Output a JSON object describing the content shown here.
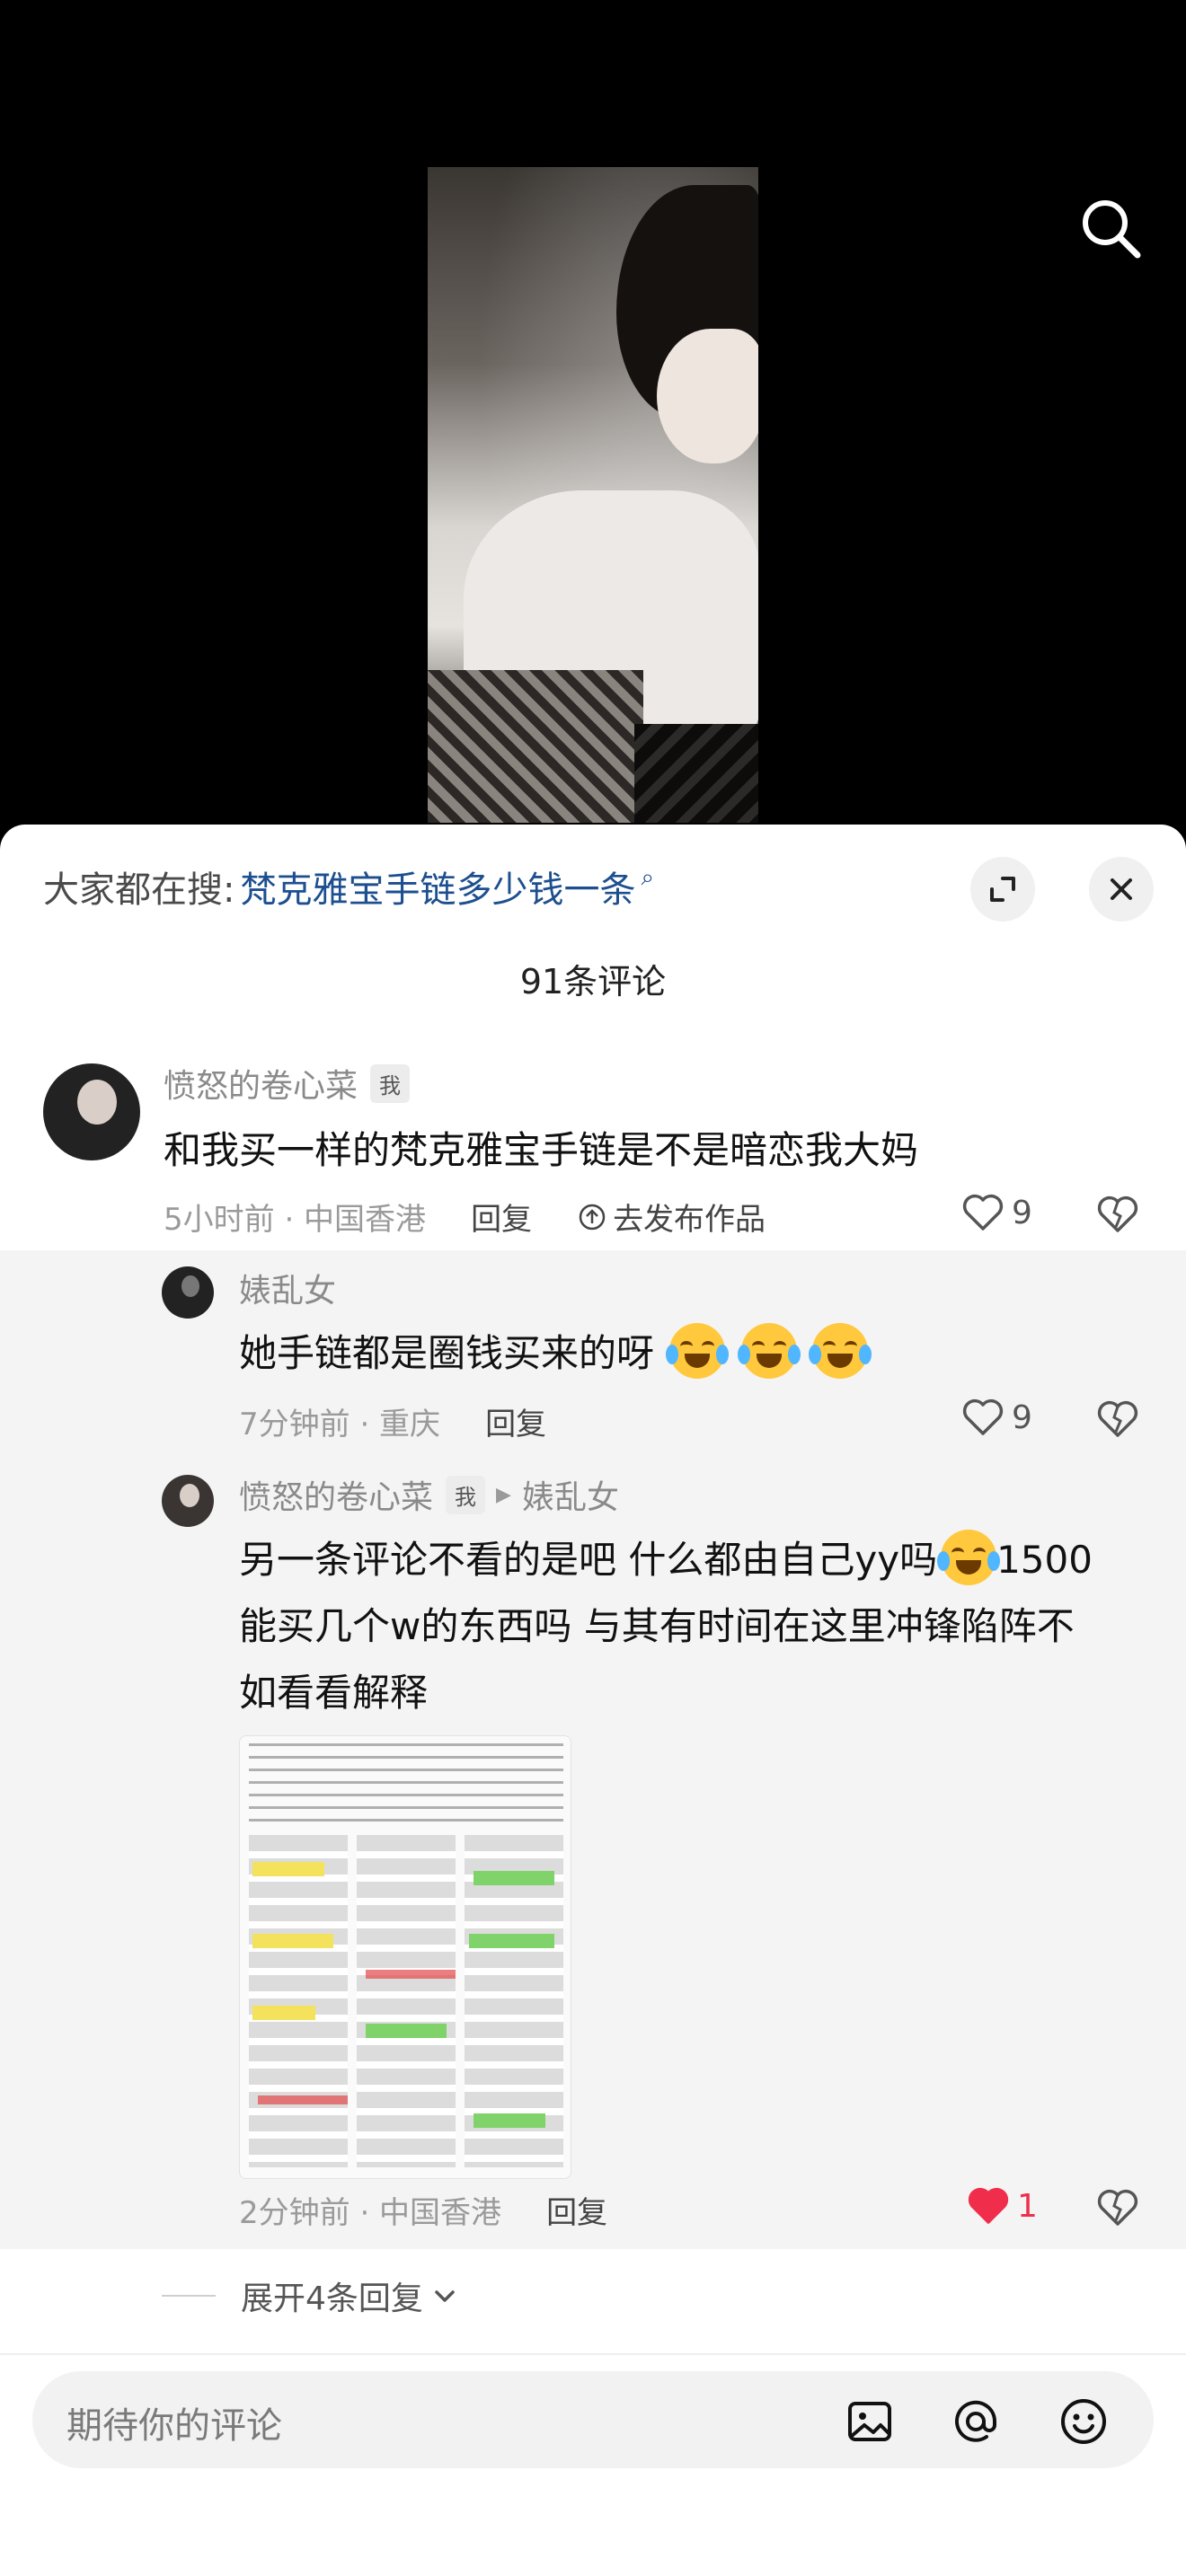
{
  "hot_search": {
    "prefix": "大家都在搜:",
    "term": "梵克雅宝手链多少钱一条",
    "search_glyph": "⌕"
  },
  "comment_count_title": "91条评论",
  "comments": [
    {
      "username": "愤怒的卷心菜",
      "me_tag": "我",
      "text": "和我买一样的梵克雅宝手链是不是暗恋我大妈",
      "meta": "5小时前 · 中国香港",
      "reply_label": "回复",
      "publish_label": "去发布作品",
      "likes": "9"
    }
  ],
  "replies": [
    {
      "username": "婊乱女",
      "text": "她手链都是圈钱买来的呀",
      "emoji_count": 3,
      "meta": "7分钟前 · 重庆",
      "reply_label": "回复",
      "likes": "9"
    },
    {
      "username": "愤怒的卷心菜",
      "me_tag": "我",
      "reply_to": "婊乱女",
      "text_line1": "另一条评论不看的是吧 什么都由自己yy吗",
      "text_line1_tail": "1500",
      "text_line2": "能买几个w的东西吗 与其有时间在这里冲锋陷阵不",
      "text_line3": "如看看解释",
      "meta": "2分钟前 · 中国香港",
      "reply_label": "回复",
      "likes": "1",
      "liked": true
    }
  ],
  "expand_label": "展开4条回复",
  "input_placeholder": "期待你的评论",
  "icons": {
    "search": "search-icon",
    "expand": "expand-icon",
    "close": "close-icon",
    "image": "image-icon",
    "mention": "at-icon",
    "emoji": "emoji-icon"
  },
  "colors": {
    "link": "#1d4f8f",
    "like_active": "#f02e4b"
  }
}
